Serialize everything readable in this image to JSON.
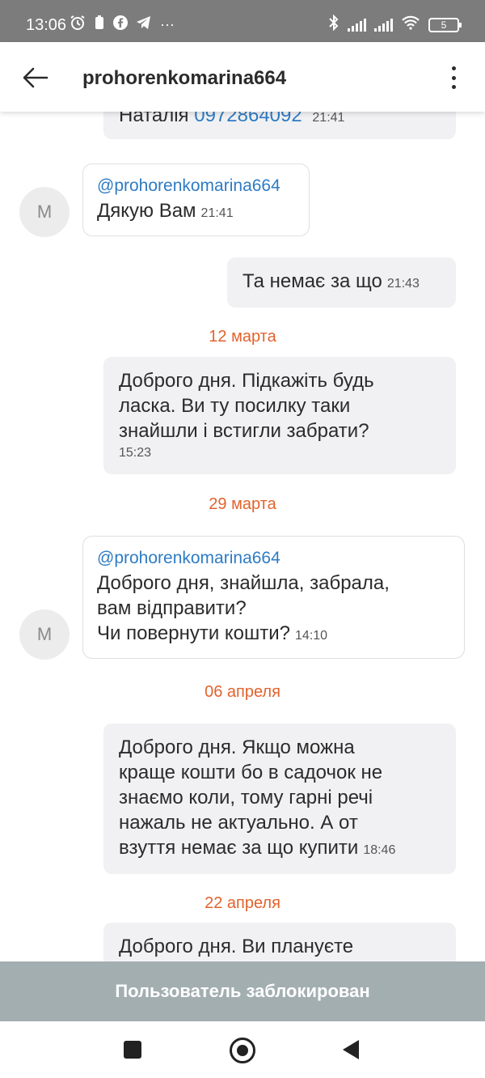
{
  "status_bar": {
    "time": "13:06",
    "left_icons": [
      "alarm-icon",
      "battery-saver-icon",
      "facebook-icon",
      "telegram-icon",
      "more-icon"
    ],
    "more_label": "···",
    "right_icons": [
      "bluetooth-icon",
      "signal-icon",
      "signal-icon",
      "wifi-icon"
    ],
    "battery_level": "5"
  },
  "header": {
    "title": "prohorenkomarina664",
    "back_icon": "arrow-left-icon",
    "menu_icon": "kebab-menu-icon"
  },
  "messages": [
    {
      "direction": "out",
      "name": "Наталія",
      "phone": "0972864092",
      "time": "21:41"
    },
    {
      "direction": "in",
      "avatar": "M",
      "mention": "@prohorenkomarina664",
      "text": "Дякую Вам",
      "time": "21:41"
    },
    {
      "direction": "out",
      "text": "Та немає за що",
      "time": "21:43"
    },
    {
      "type": "date",
      "text": "12 марта"
    },
    {
      "direction": "out",
      "lines": [
        "Доброго дня. Підкажіть будь",
        "ласка. Ви ту посилку таки",
        "знайшли і встигли забрати?"
      ],
      "time": "15:23"
    },
    {
      "type": "date",
      "text": "29 марта"
    },
    {
      "direction": "in",
      "avatar": "M",
      "mention": "@prohorenkomarina664",
      "lines": [
        "Доброго дня, знайшла, забрала,",
        "вам відправити?",
        "Чи повернути кошти?"
      ],
      "time": "14:10"
    },
    {
      "type": "date",
      "text": "06 апреля"
    },
    {
      "direction": "out",
      "lines": [
        "Доброго дня. Якщо можна",
        "краще кошти бо в садочок не",
        "знаємо коли, тому гарні речі",
        "нажаль не актуально. А от",
        "взуття немає за що купити"
      ],
      "time": "18:46"
    },
    {
      "type": "date",
      "text": "22 апреля"
    },
    {
      "direction": "out",
      "lines": [
        "Доброго дня. Ви плануєте"
      ]
    }
  ],
  "blocked_bar": {
    "text": "Пользователь заблокирован"
  },
  "nav_bar": {
    "icons": [
      "recent-apps-icon",
      "home-icon",
      "back-icon"
    ]
  },
  "colors": {
    "status_bar": "#7c7c7c",
    "accent_link": "#2e7bc4",
    "date_separator": "#e2622c",
    "outgoing_bubble": "#f1f1f3",
    "blocked_bar": "#a3aeb1"
  }
}
